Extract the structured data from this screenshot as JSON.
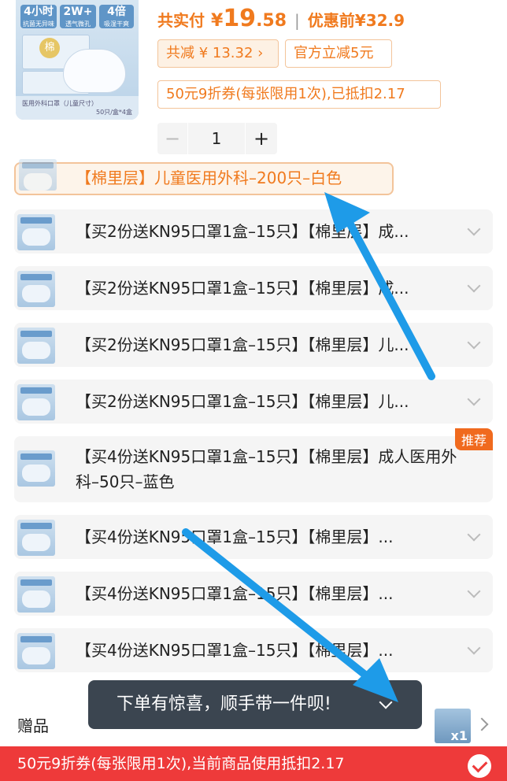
{
  "product": {
    "thumb_chips": [
      {
        "top": "4小时",
        "sub": "抗菌无异味"
      },
      {
        "top": "2W+",
        "sub": "透气微孔"
      },
      {
        "top": "4倍",
        "sub": "吸湿干爽"
      }
    ],
    "thumb_badge": "棉",
    "thumb_footer_left": "医用外科口罩（儿童尺寸）",
    "thumb_footer_right": "50只/盒*4盒"
  },
  "price": {
    "label": "共实付",
    "yen": "¥",
    "integer": "19",
    "decimal": ".58",
    "before_label": "优惠前",
    "before_value": "¥32.9"
  },
  "tags": {
    "save": "共减 ¥ 13.32 ›",
    "official": "官方立减5元",
    "coupon": "50元9折券(每张限用1次),已抵扣2.17"
  },
  "stepper": {
    "minus": "−",
    "qty": "1",
    "plus": "+"
  },
  "options": [
    {
      "label": "【棉里层】儿童医用外科–200只–白色",
      "selected": true
    },
    {
      "label": "【买2份送KN95口罩1盒–15只】【棉里层】成..."
    },
    {
      "label": "【买2份送KN95口罩1盒–15只】【棉里层】成..."
    },
    {
      "label": "【买2份送KN95口罩1盒–15只】【棉里层】儿..."
    },
    {
      "label": "【买2份送KN95口罩1盒–15只】【棉里层】儿..."
    },
    {
      "label": "【买4份送KN95口罩1盒–15只】【棉里层】成人医用外科–50只–蓝色",
      "badge": "推荐"
    },
    {
      "label": "【买4份送KN95口罩1盒–15只】【棉里层】..."
    },
    {
      "label": "【买4份送KN95口罩1盒–15只】【棉里层】..."
    },
    {
      "label": "【买4份送KN95口罩1盒–15只】【棉里层】..."
    }
  ],
  "toast": {
    "text": "下单有惊喜，顺手带一件呗!"
  },
  "gift": {
    "label": "赠品",
    "count": "x1"
  },
  "bottom_bar": {
    "text": "50元9折券(每张限用1次),当前商品使用抵扣2.17"
  },
  "colors": {
    "accent_orange": "#f07a1e",
    "bottom_red": "#ee3a3a",
    "toast_bg": "#3b4550",
    "annotation_blue": "#1e9be8"
  }
}
